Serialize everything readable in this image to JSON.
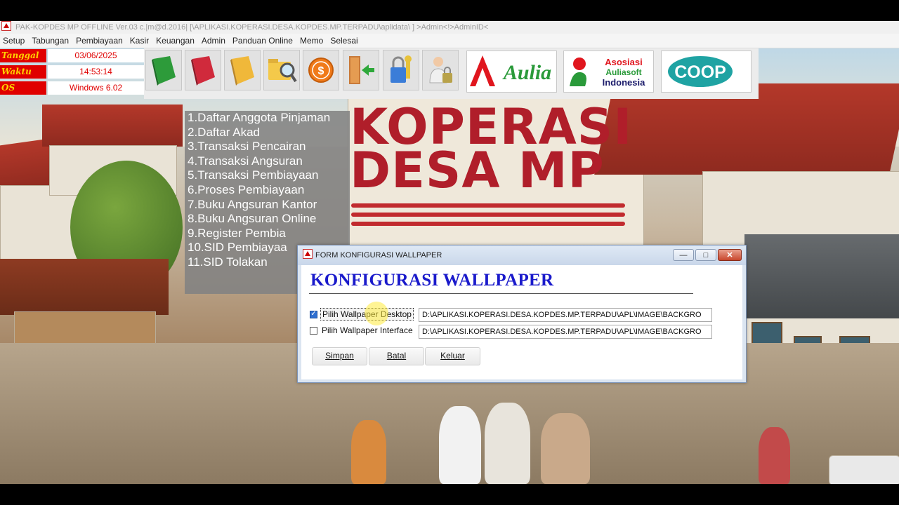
{
  "app": {
    "title": "PAK-KOPDES MP OFFLINE Ver.03 c.|m@d.2016| [\\APLIKASI.KOPERASI.DESA.KOPDES.MP.TERPADU\\aplidata\\ ] >Admin<!>AdminID<"
  },
  "menu": [
    "Setup",
    "Tabungan",
    "Pembiayaan",
    "Kasir",
    "Keuangan",
    "Admin",
    "Panduan Online",
    "Memo",
    "Selesai"
  ],
  "info": {
    "tanggal_label": "Tanggal",
    "tanggal_value": "03/06/2025",
    "waktu_label": "Waktu",
    "waktu_value": "14:53:14",
    "os_label": "OS",
    "os_value": "Windows 6.02"
  },
  "logos": {
    "aulia": "Aulia",
    "asosiasi_line1": "Asosiasi",
    "asosiasi_line2": "Auliasoft",
    "asosiasi_line3": "Indonesia",
    "coop": "COOP"
  },
  "background": {
    "line1": "KOPERASI",
    "line2": "DESA MP"
  },
  "sidemenu": [
    "1.Daftar Anggota Pinjaman",
    "2.Daftar Akad",
    "3.Transaksi Pencairan",
    "4.Transaksi Angsuran",
    "5.Transaksi Pembiayaan",
    "6.Proses Pembiayaan",
    "7.Buku Angsuran Kantor",
    "8.Buku Angsuran Online",
    "9.Register Pembia",
    "10.SID Pembiayaa",
    "11.SID Tolakan"
  ],
  "dialog": {
    "title": "FORM KONFIGURASI WALLPAPER",
    "heading": "KONFIGURASI WALLPAPER",
    "desktop_label": "Pilih Wallpaper Desktop",
    "desktop_checked": true,
    "desktop_path": "D:\\APLIKASI.KOPERASI.DESA.KOPDES.MP.TERPADU\\APL\\IMAGE\\BACKGRO",
    "interface_label": "Pilih Wallpaper Interface",
    "interface_checked": false,
    "interface_path": "D:\\APLIKASI.KOPERASI.DESA.KOPDES.MP.TERPADU\\APL\\IMAGE\\BACKGRO",
    "simpan": "Simpan",
    "batal": "Batal",
    "keluar": "Keluar"
  },
  "colors": {
    "label_red": "#e00000",
    "label_yellow": "#ffd100",
    "heading_blue": "#1a1acb"
  }
}
